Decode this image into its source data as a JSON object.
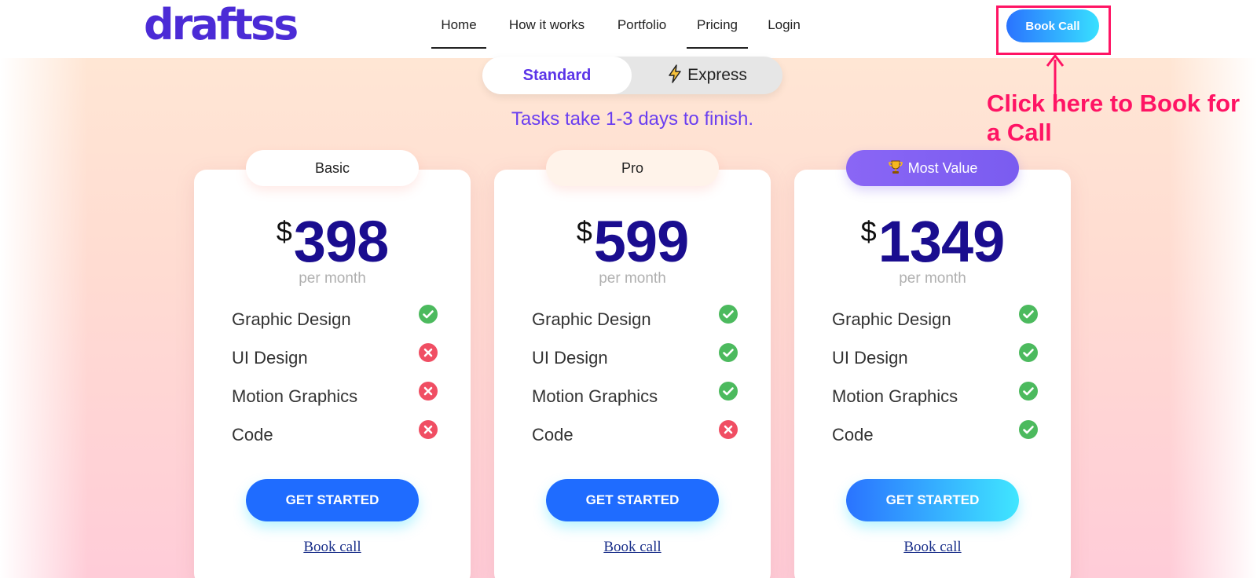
{
  "header": {
    "logo": "draftss",
    "nav": [
      {
        "label": "Home",
        "active": true
      },
      {
        "label": "How it works",
        "active": false
      },
      {
        "label": "Portfolio",
        "active": false
      },
      {
        "label": "Pricing",
        "active": true
      },
      {
        "label": "Login",
        "active": false
      }
    ],
    "book_call": "Book Call"
  },
  "toggle": {
    "standard": "Standard",
    "express": "Express",
    "selected": "Standard"
  },
  "subtitle": "Tasks take 1-3 days to finish.",
  "annotation": {
    "text": "Click here to Book for a Call",
    "color": "#ff1464"
  },
  "plans": [
    {
      "label": "Basic",
      "currency": "$",
      "price": "398",
      "period": "per month",
      "features": [
        {
          "name": "Graphic Design",
          "included": true
        },
        {
          "name": "UI Design",
          "included": false
        },
        {
          "name": "Motion Graphics",
          "included": false
        },
        {
          "name": "Code",
          "included": false
        }
      ],
      "cta": "GET STARTED",
      "link": "Book call"
    },
    {
      "label": "Pro",
      "currency": "$",
      "price": "599",
      "period": "per month",
      "features": [
        {
          "name": "Graphic Design",
          "included": true
        },
        {
          "name": "UI Design",
          "included": true
        },
        {
          "name": "Motion Graphics",
          "included": true
        },
        {
          "name": "Code",
          "included": false
        }
      ],
      "cta": "GET STARTED",
      "link": "Book call"
    },
    {
      "label": "Most Value",
      "currency": "$",
      "price": "1349",
      "period": "per month",
      "features": [
        {
          "name": "Graphic Design",
          "included": true
        },
        {
          "name": "UI Design",
          "included": true
        },
        {
          "name": "Motion Graphics",
          "included": true
        },
        {
          "name": "Code",
          "included": true
        }
      ],
      "cta": "GET STARTED",
      "link": "Book call"
    }
  ],
  "colors": {
    "brand": "#4b2bd6",
    "price": "#1a0d8f",
    "check": "#4cba5e",
    "cross": "#f04e63",
    "cta": "#1f6cff"
  }
}
